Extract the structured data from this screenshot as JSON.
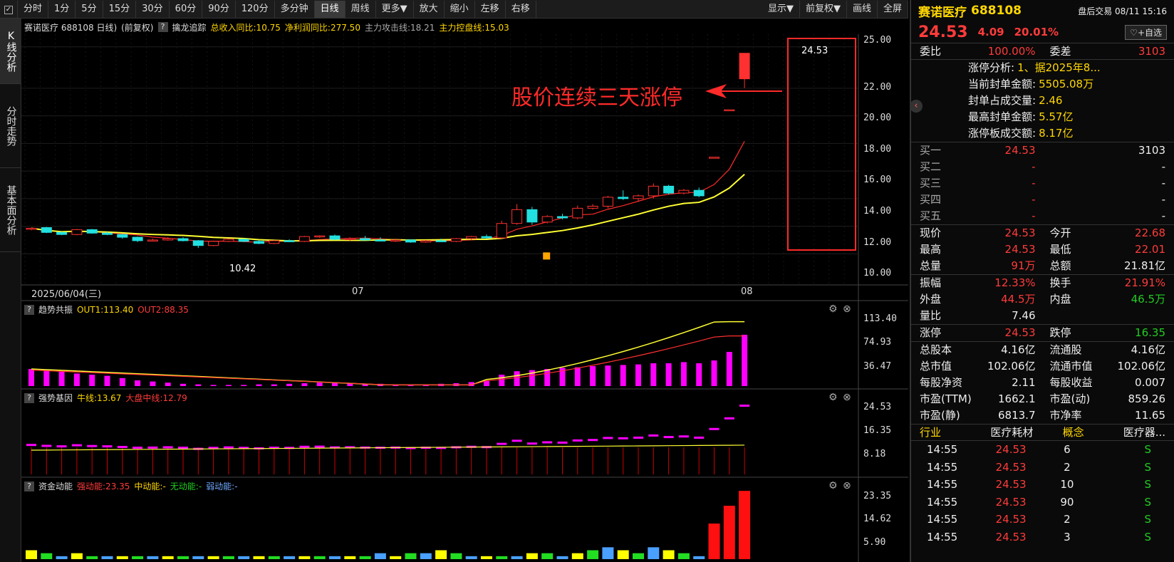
{
  "toolbar": {
    "left_items": [
      "分时",
      "1分",
      "5分",
      "15分",
      "30分",
      "60分",
      "90分",
      "120分",
      "多分钟",
      "日线",
      "周线",
      "更多▼",
      "放大",
      "缩小",
      "左移",
      "右移"
    ],
    "active": "日线",
    "right_items": [
      "显示▼",
      "前复权▼",
      "画线",
      "全屏"
    ]
  },
  "sidebar": [
    "K线分析",
    "分时走势",
    "基本面分析"
  ],
  "infobar": {
    "qmark": "?",
    "stock": "赛诺医疗 688108 日线)",
    "adjust": "(前复权)",
    "indicator": "擒龙追踪",
    "rev": "总收入同比:10.75",
    "profit": "净利润同比:277.50",
    "attack": "主力攻击线:18.21",
    "control": "主力控盘线:15.03"
  },
  "main_chart": {
    "y_ticks": [
      "25.00",
      "22.00",
      "20.00",
      "18.00",
      "16.00",
      "14.00",
      "12.00",
      "10.00"
    ],
    "x_labels": [
      "2025/06/04(三)",
      "07",
      "08"
    ],
    "annotation": "股价连续三天涨停",
    "last_price_label": "24.53",
    "low_label": "10.42"
  },
  "chart_data": {
    "type": "candlestick",
    "ylim": [
      9.5,
      25.5
    ],
    "candles": [
      [
        11.8,
        11.9,
        11.7,
        11.85
      ],
      [
        11.9,
        11.95,
        11.5,
        11.55
      ],
      [
        11.55,
        11.6,
        11.35,
        11.4
      ],
      [
        11.4,
        11.8,
        11.35,
        11.75
      ],
      [
        11.75,
        11.8,
        11.45,
        11.5
      ],
      [
        11.5,
        11.6,
        11.35,
        11.4
      ],
      [
        11.4,
        11.45,
        11.1,
        11.2
      ],
      [
        11.2,
        11.25,
        10.85,
        10.95
      ],
      [
        10.95,
        11.1,
        10.9,
        11.0
      ],
      [
        11.0,
        11.2,
        10.95,
        11.1
      ],
      [
        11.1,
        11.2,
        10.9,
        10.95
      ],
      [
        10.95,
        11.0,
        10.42,
        10.6
      ],
      [
        10.6,
        10.95,
        10.55,
        10.9
      ],
      [
        10.9,
        11.1,
        10.85,
        11.05
      ],
      [
        11.05,
        11.1,
        10.85,
        10.9
      ],
      [
        10.9,
        11.0,
        10.7,
        10.75
      ],
      [
        10.75,
        11.0,
        10.7,
        10.95
      ],
      [
        10.95,
        11.05,
        10.85,
        10.9
      ],
      [
        10.9,
        11.3,
        10.85,
        11.25
      ],
      [
        11.25,
        11.35,
        11.15,
        11.3
      ],
      [
        11.3,
        11.4,
        11.0,
        11.05
      ],
      [
        11.05,
        11.2,
        10.95,
        11.1
      ],
      [
        11.1,
        11.3,
        11.0,
        11.0
      ],
      [
        11.0,
        11.2,
        10.9,
        10.95
      ],
      [
        10.95,
        11.1,
        10.85,
        11.0
      ],
      [
        11.0,
        11.05,
        10.8,
        10.85
      ],
      [
        10.85,
        11.0,
        10.8,
        10.95
      ],
      [
        10.95,
        11.1,
        10.85,
        10.9
      ],
      [
        10.9,
        11.15,
        10.85,
        11.1
      ],
      [
        11.1,
        11.3,
        11.0,
        11.25
      ],
      [
        11.25,
        11.4,
        11.1,
        11.15
      ],
      [
        11.15,
        12.4,
        11.1,
        12.2
      ],
      [
        12.2,
        13.6,
        12.1,
        13.2
      ],
      [
        13.2,
        13.4,
        12.1,
        12.3
      ],
      [
        12.3,
        12.8,
        12.2,
        12.7
      ],
      [
        12.7,
        12.9,
        12.5,
        12.6
      ],
      [
        12.6,
        13.5,
        12.5,
        13.3
      ],
      [
        13.3,
        13.6,
        13.2,
        13.45
      ],
      [
        13.45,
        14.2,
        13.3,
        14.1
      ],
      [
        14.1,
        14.6,
        13.9,
        14.0
      ],
      [
        14.0,
        14.3,
        13.8,
        14.2
      ],
      [
        14.2,
        15.1,
        14.0,
        14.9
      ],
      [
        14.9,
        15.0,
        14.3,
        14.4
      ],
      [
        14.4,
        14.7,
        14.3,
        14.6
      ],
      [
        14.6,
        14.8,
        14.1,
        14.2
      ],
      [
        17.0,
        17.0,
        17.0,
        17.0
      ],
      [
        20.44,
        20.44,
        20.44,
        20.44
      ],
      [
        22.68,
        24.53,
        22.01,
        24.53
      ]
    ],
    "series": [
      {
        "name": "主力攻击线",
        "color": "#ff2a2a"
      },
      {
        "name": "主力控盘线",
        "color": "#ffff33"
      }
    ]
  },
  "panels": {
    "p1": {
      "name": "趋势共振",
      "out1": "OUT1:113.40",
      "out2": "OUT2:88.35",
      "ticks": [
        "113.40",
        "74.93",
        "36.47"
      ]
    },
    "p2": {
      "name": "强势基因",
      "a": "牛线:13.67",
      "b": "大盘中线:12.79",
      "ticks": [
        "24.53",
        "16.35",
        "8.18"
      ]
    },
    "p3": {
      "name": "资金动能",
      "a": "强动能:23.35",
      "b": "中动能:-",
      "c": "无动能:-",
      "d": "弱动能:-",
      "ticks": [
        "23.35",
        "14.62",
        "5.90"
      ]
    }
  },
  "right": {
    "name": "赛诺医疗",
    "code": "688108",
    "status": "盘后交易 08/11 15:16",
    "price": "24.53",
    "change": "4.09",
    "pct": "20.01%",
    "fav": "+自选",
    "weibi_l": "委比",
    "weibi": "100.00%",
    "weicha_l": "委差",
    "weicha": "3103",
    "limit": [
      [
        "涨停分析:",
        "1、据2025年8..."
      ],
      [
        "当前封单金额:",
        "5505.08万"
      ],
      [
        "封单占成交量:",
        "2.46"
      ],
      [
        "最高封单金额:",
        "5.57亿"
      ],
      [
        "涨停板成交额:",
        "8.17亿"
      ]
    ],
    "bids": [
      [
        "买一",
        "24.53",
        "3103"
      ],
      [
        "买二",
        "-",
        "-"
      ],
      [
        "买三",
        "-",
        "-"
      ],
      [
        "买四",
        "-",
        "-"
      ],
      [
        "买五",
        "-",
        "-"
      ]
    ],
    "stats1": [
      [
        "现价",
        "24.53",
        "今开",
        "22.68"
      ],
      [
        "最高",
        "24.53",
        "最低",
        "22.01"
      ],
      [
        "总量",
        "91万",
        "总额",
        "21.81亿"
      ]
    ],
    "stats2": [
      [
        "振幅",
        "12.33%",
        "换手",
        "21.91%"
      ],
      [
        "外盘",
        "44.5万",
        "内盘",
        "46.5万"
      ],
      [
        "量比",
        "7.46",
        "",
        ""
      ]
    ],
    "stats3": [
      [
        "涨停",
        "24.53",
        "跌停",
        "16.35"
      ]
    ],
    "stats4": [
      [
        "总股本",
        "4.16亿",
        "流通股",
        "4.16亿"
      ],
      [
        "总市值",
        "102.06亿",
        "流通市值",
        "102.06亿"
      ],
      [
        "每股净资",
        "2.11",
        "每股收益",
        "0.007"
      ],
      [
        "市盈(TTM)",
        "1662.1",
        "市盈(动)",
        "859.26"
      ],
      [
        "市盈(静)",
        "6813.7",
        "市净率",
        "11.65"
      ]
    ],
    "industry": [
      "行业",
      "医疗耗材",
      "概念",
      "医疗器..."
    ],
    "ticks": [
      [
        "14:55",
        "24.53",
        "6",
        "S"
      ],
      [
        "14:55",
        "24.53",
        "2",
        "S"
      ],
      [
        "14:55",
        "24.53",
        "10",
        "S"
      ],
      [
        "14:55",
        "24.53",
        "90",
        "S"
      ],
      [
        "14:55",
        "24.53",
        "2",
        "S"
      ],
      [
        "14:55",
        "24.53",
        "3",
        "S"
      ]
    ]
  }
}
